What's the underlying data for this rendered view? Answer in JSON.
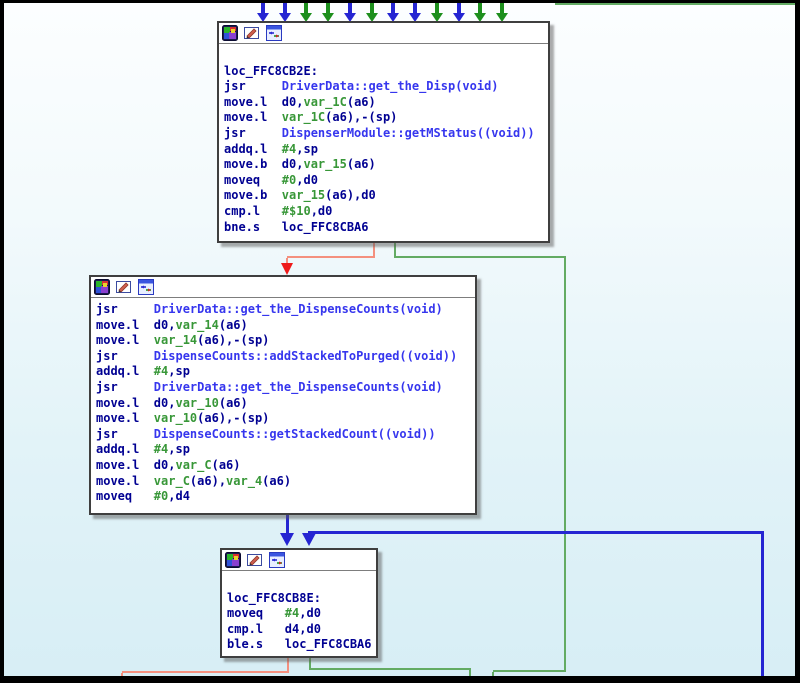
{
  "colors": {
    "edge_blue": "#2525d2",
    "edge_green_bright": "#1d8f1d",
    "edge_green_soft": "#63ab63",
    "edge_red_soft": "#f4907e",
    "edge_red_head": "#ee1b1b",
    "text_navy": "#000092",
    "text_blue": "#3636ee",
    "text_green": "#389738",
    "node_background": "#ffffff",
    "node_border": "#3f3f3f",
    "canvas_background_top": "#fcfeff",
    "canvas_background_bottom": "#d7eef5"
  },
  "incoming_arrows": [
    "blue",
    "blue",
    "green",
    "green",
    "blue",
    "green",
    "blue",
    "blue",
    "green",
    "blue",
    "green",
    "green"
  ],
  "nodes": [
    {
      "icons": [
        "color-palette-icon",
        "edit-pencil-icon",
        "graph-view-icon"
      ],
      "lines": [
        [],
        [
          [
            "loc_FFC8CB2E:",
            "n"
          ]
        ],
        [
          [
            "jsr     ",
            "n"
          ],
          [
            "DriverData::get_the_Disp(void)",
            "b"
          ]
        ],
        [
          [
            "move.l  d0,",
            "n"
          ],
          [
            "var_1C",
            "g"
          ],
          [
            "(a6)",
            "n"
          ]
        ],
        [
          [
            "move.l  ",
            "n"
          ],
          [
            "var_1C",
            "g"
          ],
          [
            "(a6),-(sp)",
            "n"
          ]
        ],
        [
          [
            "jsr     ",
            "n"
          ],
          [
            "DispenserModule::getMStatus((void))",
            "b"
          ]
        ],
        [
          [
            "addq.l  ",
            "n"
          ],
          [
            "#4",
            "g"
          ],
          [
            ",sp",
            "n"
          ]
        ],
        [
          [
            "move.b  d0,",
            "n"
          ],
          [
            "var_15",
            "g"
          ],
          [
            "(a6)",
            "n"
          ]
        ],
        [
          [
            "moveq   ",
            "n"
          ],
          [
            "#0",
            "g"
          ],
          [
            ",d0",
            "n"
          ]
        ],
        [
          [
            "move.b  ",
            "n"
          ],
          [
            "var_15",
            "g"
          ],
          [
            "(a6),d0",
            "n"
          ]
        ],
        [
          [
            "cmp.l   ",
            "n"
          ],
          [
            "#$10",
            "g"
          ],
          [
            ",d0",
            "n"
          ]
        ],
        [
          [
            "bne.s   loc_FFC8CBA6",
            "n"
          ]
        ]
      ]
    },
    {
      "icons": [
        "color-palette-icon",
        "edit-pencil-icon",
        "graph-view-icon"
      ],
      "lines": [
        [
          [
            "jsr     ",
            "n"
          ],
          [
            "DriverData::get_the_DispenseCounts(void)",
            "b"
          ]
        ],
        [
          [
            "move.l  d0,",
            "n"
          ],
          [
            "var_14",
            "g"
          ],
          [
            "(a6)",
            "n"
          ]
        ],
        [
          [
            "move.l  ",
            "n"
          ],
          [
            "var_14",
            "g"
          ],
          [
            "(a6),-(sp)",
            "n"
          ]
        ],
        [
          [
            "jsr     ",
            "n"
          ],
          [
            "DispenseCounts::addStackedToPurged((void))",
            "b"
          ]
        ],
        [
          [
            "addq.l  ",
            "n"
          ],
          [
            "#4",
            "g"
          ],
          [
            ",sp",
            "n"
          ]
        ],
        [
          [
            "jsr     ",
            "n"
          ],
          [
            "DriverData::get_the_DispenseCounts(void)",
            "b"
          ]
        ],
        [
          [
            "move.l  d0,",
            "n"
          ],
          [
            "var_10",
            "g"
          ],
          [
            "(a6)",
            "n"
          ]
        ],
        [
          [
            "move.l  ",
            "n"
          ],
          [
            "var_10",
            "g"
          ],
          [
            "(a6),-(sp)",
            "n"
          ]
        ],
        [
          [
            "jsr     ",
            "n"
          ],
          [
            "DispenseCounts::getStackedCount((void))",
            "b"
          ]
        ],
        [
          [
            "addq.l  ",
            "n"
          ],
          [
            "#4",
            "g"
          ],
          [
            ",sp",
            "n"
          ]
        ],
        [
          [
            "move.l  d0,",
            "n"
          ],
          [
            "var_C",
            "g"
          ],
          [
            "(a6)",
            "n"
          ]
        ],
        [
          [
            "move.l  ",
            "n"
          ],
          [
            "var_C",
            "g"
          ],
          [
            "(a6),",
            "n"
          ],
          [
            "var_4",
            "g"
          ],
          [
            "(a6)",
            "n"
          ]
        ],
        [
          [
            "moveq   ",
            "n"
          ],
          [
            "#0",
            "g"
          ],
          [
            ",d4",
            "n"
          ]
        ]
      ]
    },
    {
      "icons": [
        "color-palette-icon",
        "edit-pencil-icon",
        "graph-view-icon"
      ],
      "lines": [
        [],
        [
          [
            "loc_FFC8CB8E:",
            "n"
          ]
        ],
        [
          [
            "moveq   ",
            "n"
          ],
          [
            "#4",
            "g"
          ],
          [
            ",d0",
            "n"
          ]
        ],
        [
          [
            "cmp.l   d4,d0",
            "n"
          ]
        ],
        [
          [
            "ble.s   loc_FFC8CBA6",
            "n"
          ]
        ]
      ]
    }
  ],
  "edges": [
    {
      "from": "loc_FFC8CB2E",
      "to": "middle-block",
      "color": "red",
      "kind": "branch-not-taken"
    },
    {
      "from": "loc_FFC8CB2E",
      "to": "loc_FFC8CBA6-offscreen",
      "color": "green",
      "kind": "branch-taken"
    },
    {
      "from": "middle-block",
      "to": "loc_FFC8CB8E",
      "color": "blue",
      "kind": "fall-through"
    },
    {
      "from": "offscreen-below",
      "to": "loc_FFC8CB8E",
      "color": "blue",
      "kind": "loop-back"
    },
    {
      "from": "loc_FFC8CB8E",
      "to": "offscreen-below-left",
      "color": "red",
      "kind": "branch-not-taken"
    },
    {
      "from": "loc_FFC8CB8E",
      "to": "offscreen-below-right",
      "color": "green",
      "kind": "branch-taken"
    },
    {
      "from": "offscreen-top-right",
      "to": "offscreen",
      "color": "green",
      "kind": "pass-through"
    }
  ]
}
